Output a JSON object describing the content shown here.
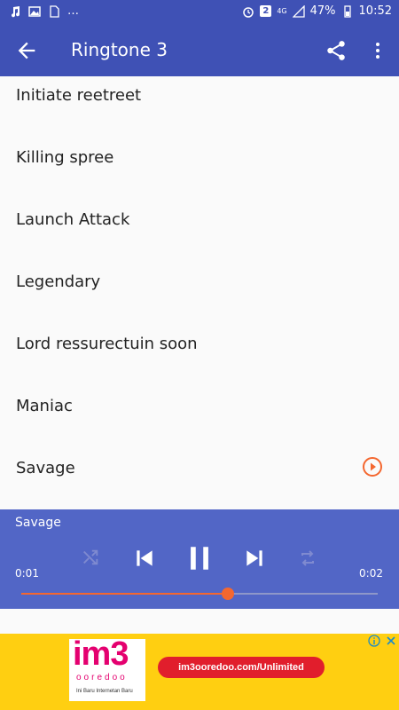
{
  "status_bar": {
    "notification_count": "2",
    "network": "4G",
    "battery": "47%",
    "time": "10:52"
  },
  "app_bar": {
    "title": "Ringtone 3"
  },
  "list": {
    "items": [
      "Initiate reetreet",
      "Killing spree",
      "Launch Attack",
      "Legendary",
      "Lord ressurectuin soon",
      "Maniac",
      "Savage"
    ]
  },
  "player": {
    "now_playing": "Savage",
    "elapsed": "0:01",
    "duration": "0:02",
    "progress": 0.58
  },
  "ad": {
    "brand": "im3",
    "sub": "ooredoo",
    "tagline": "Ini Baru Internetan Baru",
    "cta": "im3ooredoo.com/Unlimited"
  },
  "colors": {
    "primary": "#3f51b5",
    "player": "#5266c6",
    "accent": "#f4672f",
    "ad_bg": "#ffcf11",
    "ad_button": "#e11e2c"
  },
  "icons": [
    "back-arrow-icon",
    "share-icon",
    "more-vert-icon",
    "play-circle-icon",
    "shuffle-icon",
    "skip-previous-icon",
    "pause-icon",
    "skip-next-icon",
    "repeat-icon",
    "ad-info-icon",
    "ad-close-icon"
  ]
}
